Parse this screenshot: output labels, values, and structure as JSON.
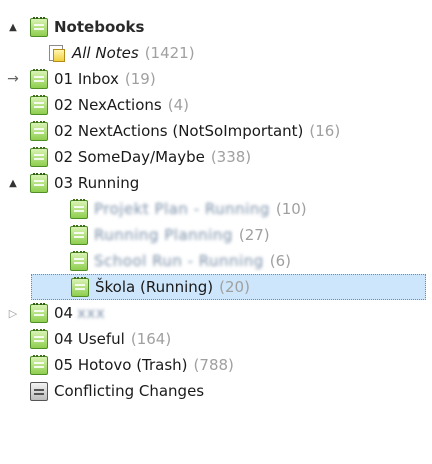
{
  "tree": {
    "notebooks": {
      "label": "Notebooks",
      "expander": "▲"
    },
    "all_notes": {
      "label": "All Notes",
      "count": "(1421)"
    },
    "items": [
      {
        "label": "01 Inbox",
        "count": "(19)",
        "marker": "→"
      },
      {
        "label": "02 NexActions",
        "count": "(4)"
      },
      {
        "label": "02 NextActions (NotSoImportant)",
        "count": "(16)"
      },
      {
        "label": "02 SomeDay/Maybe",
        "count": "(338)"
      }
    ],
    "running": {
      "label": "03 Running",
      "expander": "▲",
      "children": [
        {
          "label": "Projekt Plan - Running",
          "count": "(10)"
        },
        {
          "label": "Running Planning",
          "count": "(27)"
        },
        {
          "label": "School Run - Running",
          "count": "(6)"
        },
        {
          "label": "Škola (Running)",
          "count": "(20)"
        }
      ]
    },
    "stack_04": {
      "label": "04",
      "hidden": "xxx",
      "expander": "▷"
    },
    "after": [
      {
        "label": "04 Useful",
        "count": "(164)"
      },
      {
        "label": "05 Hotovo (Trash)",
        "count": "(788)"
      }
    ],
    "conflicting": {
      "label": "Conflicting Changes"
    }
  },
  "colors": {
    "selection": "#cde6fb",
    "notebook_green": "#8fce4f",
    "count_grey": "#a0a0a0"
  }
}
